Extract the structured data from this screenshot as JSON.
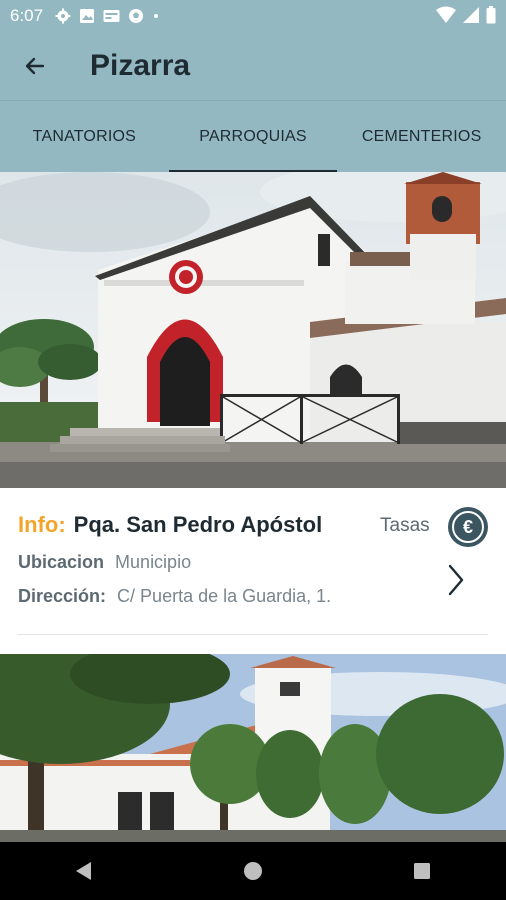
{
  "status_bar": {
    "time": "6:07",
    "icons": [
      "gear-icon",
      "image-icon",
      "card-icon",
      "ball-icon",
      "dot-icon"
    ],
    "right_icons": [
      "wifi-icon",
      "signal-icon",
      "battery-icon"
    ]
  },
  "app_bar": {
    "title": "Pizarra",
    "back_icon": "arrow-left-icon"
  },
  "tabs": [
    {
      "label": "TANATORIOS",
      "active": false
    },
    {
      "label": "PARROQUIAS",
      "active": true
    },
    {
      "label": "CEMENTERIOS",
      "active": false
    }
  ],
  "item": {
    "info_label": "Info:",
    "name": "Pqa. San Pedro Apóstol",
    "tasas_label": "Tasas",
    "tasas_icon": "euro-icon",
    "ubicacion_label": "Ubicacion",
    "ubicacion_value": "Municipio",
    "direccion_label": "Dirección:",
    "direccion_value": "C/ Puerta de la Guardia, 1."
  },
  "colors": {
    "app_bar": "#94b8c2",
    "accent": "#f3a52b",
    "title": "#1f2b33",
    "euro_button": "#3b5660"
  },
  "nav_bar": {
    "back": "back-triangle-icon",
    "home": "home-circle-icon",
    "recents": "recents-square-icon"
  }
}
